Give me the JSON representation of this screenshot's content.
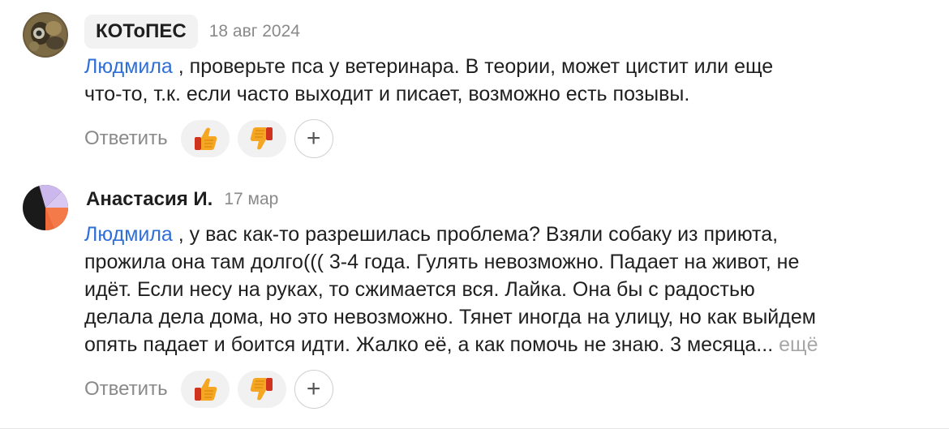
{
  "comments": [
    {
      "author": "КОТоПЕС",
      "date": "18 авг 2024",
      "mention": "Людмила",
      "text_line_1": " , проверьте пса у ветеринара. В теории, может цистит или еще",
      "text_line_2": "что-то, т.к. если часто выходит и писает, возможно есть позывы.",
      "reply_label": "Ответить",
      "like_icon": "thumbs-up-icon",
      "dislike_icon": "thumbs-down-icon",
      "add_reaction_label": "+"
    },
    {
      "author": "Анастасия И.",
      "date": "17 мар",
      "mention": "Людмила",
      "text_line_1": " , у вас как-то разрешилась проблема? Взяли собаку из приюта,",
      "text_line_2": "прожила она там долго((( 3-4 года. Гулять невозможно. Падает на живот, не",
      "text_line_3": "идёт. Если несу на руках, то сжимается вся. Лайка. Она бы с радостью",
      "text_line_4": "делала дела дома, но это невозможно. Тянет иногда на улицу, но как выйдем",
      "text_line_5": "опять падает и боится идти. Жалко её, а как помочь не знаю. 3 месяца...",
      "more_label": "ещё",
      "reply_label": "Ответить",
      "like_icon": "thumbs-up-icon",
      "dislike_icon": "thumbs-down-icon",
      "add_reaction_label": "+"
    }
  ]
}
